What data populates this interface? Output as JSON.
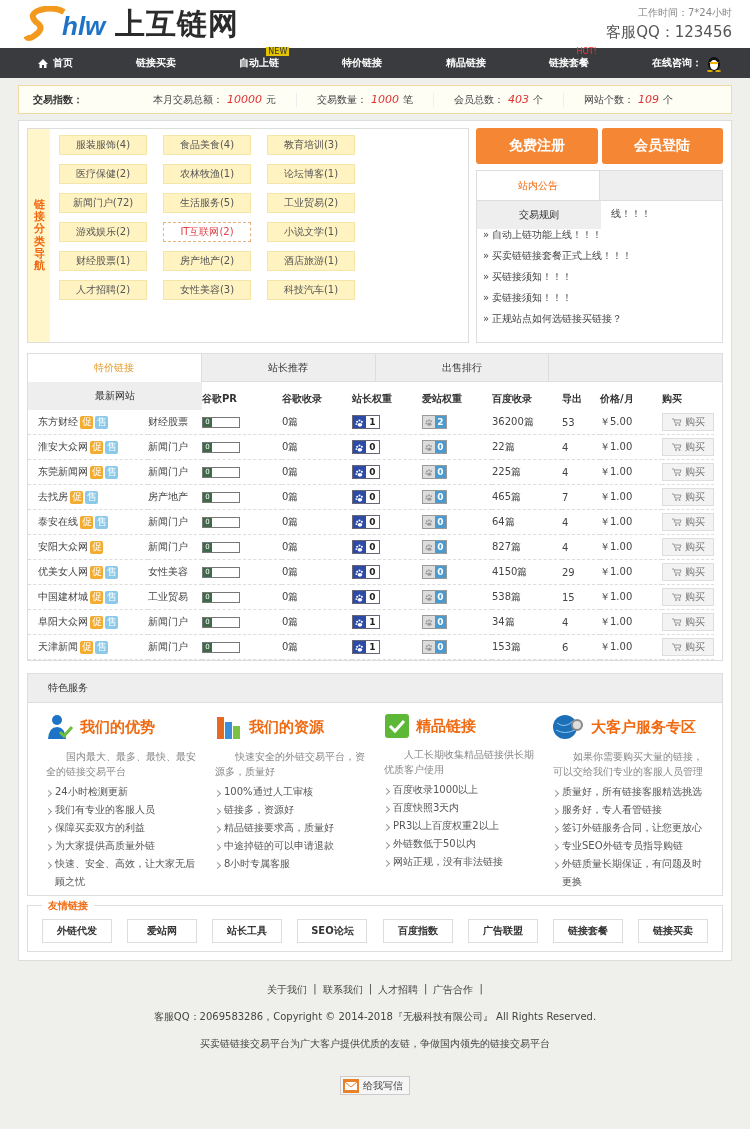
{
  "header": {
    "logo_mark": "hlw",
    "site_name": "上互链网",
    "work_hours": "工作时间：7*24小时",
    "service_qq": "客服QQ：123456"
  },
  "nav": {
    "items": [
      {
        "label": "首页",
        "kind": "home"
      },
      {
        "label": "链接买卖",
        "kind": "plain"
      },
      {
        "label": "自动上链",
        "kind": "plain",
        "badge": "NEW"
      },
      {
        "label": "特价链接",
        "kind": "plain"
      },
      {
        "label": "精品链接",
        "kind": "plain"
      },
      {
        "label": "链接套餐",
        "kind": "plain",
        "badge": "HOT!"
      }
    ],
    "consult": "在线咨询："
  },
  "stats": {
    "label": "交易指数：",
    "items": [
      {
        "label": "本月交易总额：",
        "value": "10000",
        "unit": "元"
      },
      {
        "label": "交易数量：",
        "value": "1000",
        "unit": "笔"
      },
      {
        "label": "会员总数：",
        "value": "403",
        "unit": "个"
      },
      {
        "label": "网站个数：",
        "value": "109",
        "unit": "个"
      }
    ]
  },
  "categories": {
    "title": "链接分类导航",
    "items": [
      {
        "label": "服装服饰(4)",
        "selected": false
      },
      {
        "label": "食品美食(4)",
        "selected": false
      },
      {
        "label": "教育培训(3)",
        "selected": false
      },
      {
        "label": "医疗保健(2)",
        "selected": false
      },
      {
        "label": "农林牧渔(1)",
        "selected": false
      },
      {
        "label": "论坛博客(1)",
        "selected": false
      },
      {
        "label": "新闻门户(72)",
        "selected": false
      },
      {
        "label": "生活服务(5)",
        "selected": false
      },
      {
        "label": "工业贸易(2)",
        "selected": false
      },
      {
        "label": "游戏娱乐(2)",
        "selected": false
      },
      {
        "label": "IT互联网(2)",
        "selected": true
      },
      {
        "label": "小说文学(1)",
        "selected": false
      },
      {
        "label": "财经股票(1)",
        "selected": false
      },
      {
        "label": "房产地产(2)",
        "selected": false
      },
      {
        "label": "酒店旅游(1)",
        "selected": false
      },
      {
        "label": "人才招聘(2)",
        "selected": false
      },
      {
        "label": "女性美容(3)",
        "selected": false
      },
      {
        "label": "科技汽车(1)",
        "selected": false
      }
    ]
  },
  "account_buttons": [
    "免费注册",
    "会员登陆"
  ],
  "notices": {
    "tabs": [
      {
        "label": "站内公告",
        "selected": true
      },
      {
        "selected": false
      }
    ],
    "dropdown": "交易规则",
    "items": [
      "线！！！",
      "» 自动上链功能上线！！！",
      "» 买卖链链接套餐正式上线！！！",
      "» 买链接须知！！！",
      "» 卖链接须知！！！",
      "» 正规站点如何选链接买链接？"
    ]
  },
  "links_table": {
    "tabs": [
      {
        "label": "特价链接",
        "selected": true
      },
      {
        "label": "站长推荐",
        "selected": false
      },
      {
        "label": "出售排行",
        "selected": false
      },
      {
        "selected": false
      }
    ],
    "group_heading": "最新网站",
    "columns": [
      "谷歌PR",
      "谷歌收录",
      "站长权重",
      "爱站权重",
      "百度收录",
      "导出",
      "价格/月",
      "购买"
    ],
    "rows": [
      {
        "name": "东方财经",
        "badges": [
          {
            "text": "促",
            "kind": "promo"
          },
          {
            "text": "售",
            "kind": "sale"
          }
        ],
        "category": "财经股票",
        "pr": "0",
        "google": "0篇",
        "weight": "1",
        "aizhan": "2",
        "baidu": "36200篇",
        "out": "53",
        "price": "￥5.00",
        "buy": "购买"
      },
      {
        "name": "淮安大众网",
        "badges": [
          {
            "text": "促",
            "kind": "promo"
          },
          {
            "text": "售",
            "kind": "sale"
          }
        ],
        "category": "新闻门户",
        "pr": "0",
        "google": "0篇",
        "weight": "0",
        "aizhan": "0",
        "baidu": "22篇",
        "out": "4",
        "price": "￥1.00",
        "buy": "购买"
      },
      {
        "name": "东莞新闻网",
        "badges": [
          {
            "text": "促",
            "kind": "promo"
          },
          {
            "text": "售",
            "kind": "sale"
          }
        ],
        "category": "新闻门户",
        "pr": "0",
        "google": "0篇",
        "weight": "0",
        "aizhan": "0",
        "baidu": "225篇",
        "out": "4",
        "price": "￥1.00",
        "buy": "购买"
      },
      {
        "name": "去找房",
        "badges": [
          {
            "text": "促",
            "kind": "promo"
          },
          {
            "text": "售",
            "kind": "sale"
          }
        ],
        "category": "房产地产",
        "pr": "0",
        "google": "0篇",
        "weight": "0",
        "aizhan": "0",
        "baidu": "465篇",
        "out": "7",
        "price": "￥1.00",
        "buy": "购买"
      },
      {
        "name": "泰安在线",
        "badges": [
          {
            "text": "促",
            "kind": "promo"
          },
          {
            "text": "售",
            "kind": "sale"
          }
        ],
        "category": "新闻门户",
        "pr": "0",
        "google": "0篇",
        "weight": "0",
        "aizhan": "0",
        "baidu": "64篇",
        "out": "4",
        "price": "￥1.00",
        "buy": "购买"
      },
      {
        "name": "安阳大众网",
        "badges": [
          {
            "text": "促",
            "kind": "promo"
          }
        ],
        "category": "新闻门户",
        "pr": "0",
        "google": "0篇",
        "weight": "0",
        "aizhan": "0",
        "baidu": "827篇",
        "out": "4",
        "price": "￥1.00",
        "buy": "购买"
      },
      {
        "name": "优美女人网",
        "badges": [
          {
            "text": "促",
            "kind": "promo"
          },
          {
            "text": "售",
            "kind": "sale"
          }
        ],
        "category": "女性美容",
        "pr": "0",
        "google": "0篇",
        "weight": "0",
        "aizhan": "0",
        "baidu": "4150篇",
        "out": "29",
        "price": "￥1.00",
        "buy": "购买"
      },
      {
        "name": "中国建材城",
        "badges": [
          {
            "text": "促",
            "kind": "promo"
          },
          {
            "text": "售",
            "kind": "sale"
          }
        ],
        "category": "工业贸易",
        "pr": "0",
        "google": "0篇",
        "weight": "0",
        "aizhan": "0",
        "baidu": "538篇",
        "out": "15",
        "price": "￥1.00",
        "buy": "购买"
      },
      {
        "name": "阜阳大众网",
        "badges": [
          {
            "text": "促",
            "kind": "promo"
          },
          {
            "text": "售",
            "kind": "sale"
          }
        ],
        "category": "新闻门户",
        "pr": "0",
        "google": "0篇",
        "weight": "1",
        "aizhan": "0",
        "baidu": "34篇",
        "out": "4",
        "price": "￥1.00",
        "buy": "购买"
      },
      {
        "name": "天津新闻",
        "badges": [
          {
            "text": "促",
            "kind": "promo"
          },
          {
            "text": "售",
            "kind": "sale"
          }
        ],
        "category": "新闻门户",
        "pr": "0",
        "google": "0篇",
        "weight": "1",
        "aizhan": "0",
        "baidu": "153篇",
        "out": "6",
        "price": "￥1.00",
        "buy": "购买"
      }
    ]
  },
  "services": {
    "title": "特色服务",
    "columns": [
      {
        "kind": "user",
        "title": "我们的优势",
        "intro": "国内最大、最多、最快、最安全的链接交易平台",
        "points": [
          "24小时检测更新",
          "我们有专业的客服人员",
          "保障买卖双方的利益",
          "为大家提供高质量外链",
          "快速、安全、高效，让大家无后顾之忧"
        ]
      },
      {
        "kind": "books",
        "title": "我们的资源",
        "intro": "快速安全的外链交易平台，资源多，质量好",
        "points": [
          "100%通过人工审核",
          "链接多，资源好",
          "精品链接要求高，质量好",
          "中途掉链的可以申请退款",
          "8小时专属客服"
        ]
      },
      {
        "kind": "check",
        "title": "精品链接",
        "intro": "人工长期收集精品链接供长期优质客户使用",
        "points": [
          "百度收录1000以上",
          "百度快照3天内",
          "PR3以上百度权重2以上",
          "外链数低于50以内",
          "网站正规，没有非法链接"
        ]
      },
      {
        "kind": "globe",
        "title": "大客户服务专区",
        "intro": "如果你需要购买大量的链接，可以交给我们专业的客服人员管理",
        "points": [
          "质量好，所有链接客服精选挑选",
          "服务好，专人看管链接",
          "签订外链服务合同，让您更放心",
          "专业SEO外链专员指导购链",
          "外链质量长期保证，有问题及时更换"
        ]
      }
    ]
  },
  "friend_links": {
    "title": "友情链接",
    "items": [
      "外链代发",
      "爱站网",
      "站长工具",
      "SEO论坛",
      "百度指数",
      "广告联盟",
      "链接套餐",
      "链接买卖"
    ]
  },
  "footer": {
    "links": [
      "关于我们",
      "联系我们",
      "人才招聘",
      "广告合作"
    ],
    "separator": "|",
    "copyright": "客服QQ：2069583286，Copyright © 2014-2018『无极科技有限公司』 All Rights Reserved.",
    "tagline": "买卖链链接交易平台为广大客户提供优质的友链，争做国内领先的链接交易平台",
    "mail_button": "给我写信"
  }
}
